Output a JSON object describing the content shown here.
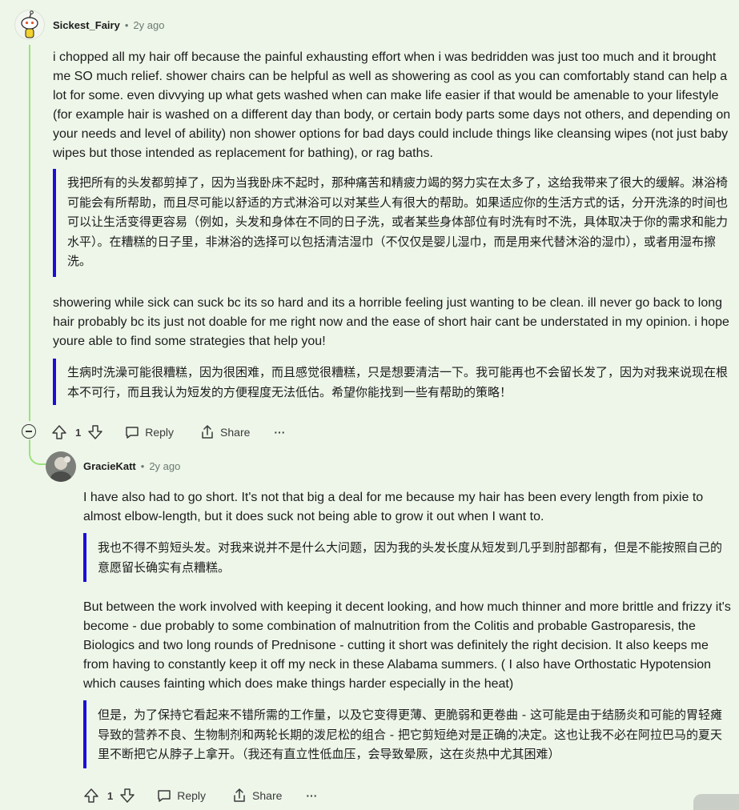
{
  "comment1": {
    "username": "Sickest_Fairy",
    "age": "2y ago",
    "paragraph1": "i chopped all my hair off because the painful exhausting effort when i was bedridden was just too much and it brought me SO much relief. shower chairs can be helpful as well as showering as cool as you can comfortably stand can help a lot for some. even divvying up what gets washed when can make life easier if that would be amenable to your lifestyle (for example hair is washed on a different day than body, or certain body parts some days not others, and depending on your needs and level of ability) non shower options for bad days could include things like cleansing wipes (not just baby wipes but those intended as replacement for bathing), or rag baths.",
    "translation1": "我把所有的头发都剪掉了，因为当我卧床不起时，那种痛苦和精疲力竭的努力实在太多了，这给我带来了很大的缓解。淋浴椅可能会有所帮助，而且尽可能以舒适的方式淋浴可以对某些人有很大的帮助。如果适应你的生活方式的话，分开洗涤的时间也可以让生活变得更容易（例如，头发和身体在不同的日子洗，或者某些身体部位有时洗有时不洗，具体取决于你的需求和能力水平）。在糟糕的日子里，非淋浴的选择可以包括清洁湿巾（不仅仅是婴儿湿巾，而是用来代替沐浴的湿巾），或者用湿布擦洗。",
    "paragraph2": "showering while sick can suck bc its so hard and its a horrible feeling just wanting to be clean. ill never go back to long hair probably bc its just not doable for me right now and the ease of short hair cant be understated in my opinion. i hope youre able to find some strategies that help you!",
    "translation2": "生病时洗澡可能很糟糕，因为很困难，而且感觉很糟糕，只是想要清洁一下。我可能再也不会留长发了，因为对我来说现在根本不可行，而且我认为短发的方便程度无法低估。希望你能找到一些有帮助的策略！",
    "score": "1",
    "reply_label": "Reply",
    "share_label": "Share",
    "more_label": "···"
  },
  "comment2": {
    "username": "GracieKatt",
    "age": "2y ago",
    "paragraph1": "I have also had to go short. It's not that big a deal for me because my hair has been every length from pixie to almost elbow-length, but it does suck not being able to grow it out when I want to.",
    "translation1": "我也不得不剪短头发。对我来说并不是什么大问题，因为我的头发长度从短发到几乎到肘部都有，但是不能按照自己的意愿留长确实有点糟糕。",
    "paragraph2": "But between the work involved with keeping it decent looking, and how much thinner and more brittle and frizzy it's become - due probably to some combination of malnutrition from the Colitis and probable Gastroparesis, the Biologics and two long rounds of Prednisone - cutting it short was definitely the right decision. It also keeps me from having to constantly keep it off my neck in these Alabama summers. ( I also have Orthostatic Hypotension which causes fainting which does make things harder especially in the heat)",
    "translation2": "但是，为了保持它看起来不错所需的工作量，以及它变得更薄、更脆弱和更卷曲 - 这可能是由于结肠炎和可能的胃轻瘫导致的营养不良、生物制剂和两轮长期的泼尼松的组合 - 把它剪短绝对是正确的决定。这也让我不必在阿拉巴马的夏天里不断把它从脖子上拿开。（我还有直立性低血压，会导致晕厥，这在炎热中尤其困难）",
    "score": "1",
    "reply_label": "Reply",
    "share_label": "Share",
    "more_label": "···"
  },
  "colors": {
    "background": "#eef6e9",
    "thread_line": "#9be27c",
    "quote_bar": "#1a0ed8"
  }
}
